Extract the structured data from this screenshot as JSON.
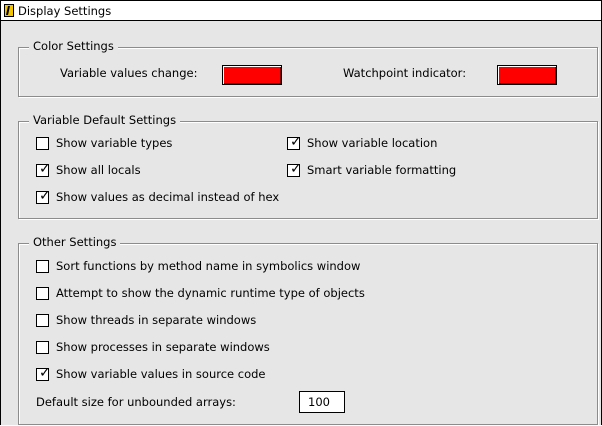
{
  "window": {
    "title": "Display Settings"
  },
  "color_settings": {
    "label": "Color Settings",
    "variable_values_change_label": "Variable values change:",
    "variable_values_change_color": "#ff0000",
    "watchpoint_indicator_label": "Watchpoint indicator:",
    "watchpoint_indicator_color": "#ff0000"
  },
  "variable_defaults": {
    "label": "Variable Default Settings",
    "show_variable_types": {
      "label": "Show variable types",
      "checked": false
    },
    "show_variable_location": {
      "label": "Show variable location",
      "checked": true
    },
    "show_all_locals": {
      "label": "Show all locals",
      "checked": true
    },
    "smart_variable_formatting": {
      "label": "Smart variable formatting",
      "checked": true
    },
    "show_values_decimal": {
      "label": "Show values as decimal instead of hex",
      "checked": true
    }
  },
  "other_settings": {
    "label": "Other Settings",
    "sort_functions": {
      "label": "Sort functions by method name in symbolics window",
      "checked": false
    },
    "dynamic_runtime_type": {
      "label": "Attempt to show the dynamic runtime type of objects",
      "checked": false
    },
    "threads_separate": {
      "label": "Show threads in separate windows",
      "checked": false
    },
    "processes_separate": {
      "label": "Show processes in separate windows",
      "checked": false
    },
    "variable_values_source": {
      "label": "Show variable values in source code",
      "checked": true
    },
    "default_size_label": "Default size for unbounded arrays:",
    "default_size_value": "100"
  },
  "icons": {
    "checkmark": "✓",
    "app_icon": "debugger-app-icon"
  }
}
